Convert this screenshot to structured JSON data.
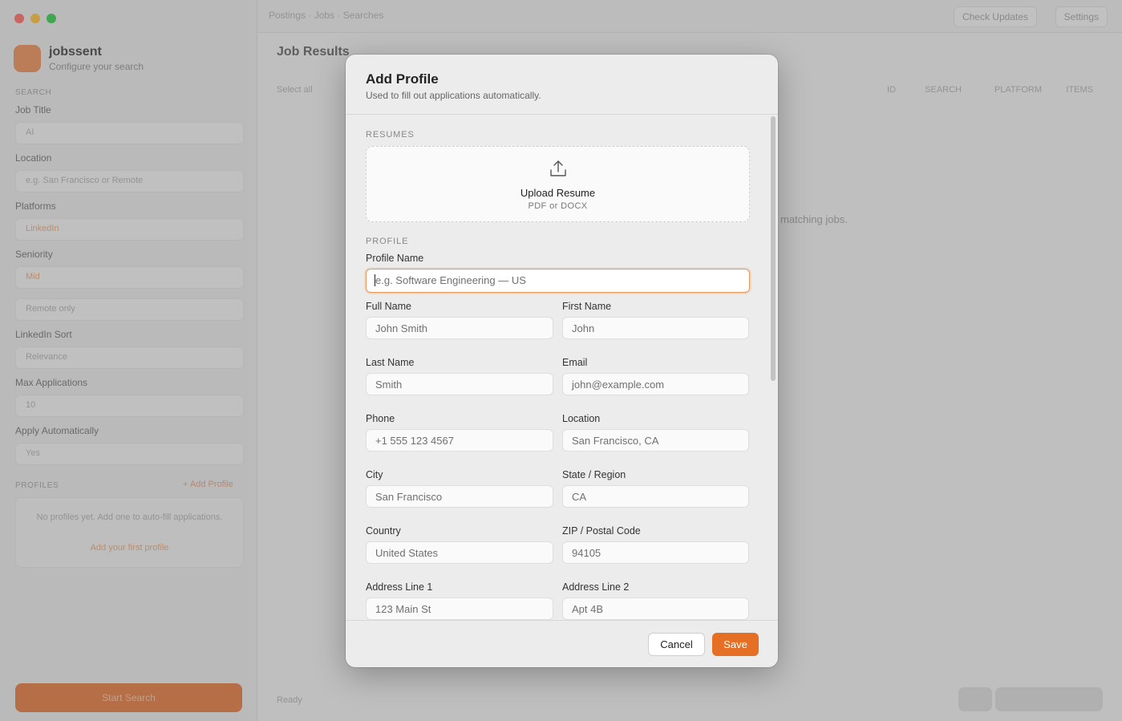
{
  "app": {
    "name": "jobssent",
    "subtitle": "Configure your search"
  },
  "sidebar": {
    "search_section": "SEARCH",
    "fields": [
      {
        "label": "Job Title",
        "value": "AI"
      },
      {
        "label": "Location",
        "value": "e.g. San Francisco or Remote"
      },
      {
        "label": "Platforms",
        "value": "LinkedIn"
      },
      {
        "label": "Seniority",
        "value": "Mid"
      },
      {
        "label": "",
        "value": "Remote only"
      },
      {
        "label": "LinkedIn Sort",
        "value": "Relevance"
      },
      {
        "label": "Max Applications",
        "value": "10"
      },
      {
        "label": "Apply Automatically",
        "value": "Yes"
      }
    ],
    "profiles_section": "PROFILES",
    "add_profile": "+ Add Profile",
    "profiles_empty": "No profiles yet. Add one to auto-fill applications.",
    "profiles_link": "Add your first profile",
    "run_button": "Start Search"
  },
  "toolbar": {
    "breadcrumb": "Postings · Jobs · Searches",
    "check_updates": "Check Updates",
    "settings": "Settings"
  },
  "main": {
    "title": "Job Results",
    "select_all": "Select all",
    "columns": [
      "ID",
      "SEARCH",
      "PLATFORM",
      "ITEMS"
    ],
    "empty_text": "matching jobs.",
    "status_left": "Ready"
  },
  "dialog": {
    "title": "Add Profile",
    "subtitle": "Used to fill out applications automatically.",
    "resumes_section": "RESUMES",
    "upload_title": "Upload Resume",
    "upload_sub": "PDF or DOCX",
    "profile_section": "PROFILE",
    "profile_name_label": "Profile Name",
    "profile_name_placeholder": "e.g. Software Engineering — US",
    "fields": [
      {
        "label": "Full Name",
        "placeholder": "John Smith"
      },
      {
        "label": "First Name",
        "placeholder": "John"
      },
      {
        "label": "Last Name",
        "placeholder": "Smith"
      },
      {
        "label": "Email",
        "placeholder": "john@example.com"
      },
      {
        "label": "Phone",
        "placeholder": "+1 555 123 4567"
      },
      {
        "label": "Location",
        "placeholder": "San Francisco, CA"
      },
      {
        "label": "City",
        "placeholder": "San Francisco"
      },
      {
        "label": "State / Region",
        "placeholder": "CA"
      },
      {
        "label": "Country",
        "placeholder": "United States"
      },
      {
        "label": "ZIP / Postal Code",
        "placeholder": "94105"
      },
      {
        "label": "Address Line 1",
        "placeholder": "123 Main St"
      },
      {
        "label": "Address Line 2",
        "placeholder": "Apt 4B"
      }
    ],
    "cancel": "Cancel",
    "save": "Save"
  },
  "colors": {
    "accent": "#e46f25",
    "focus_ring": "#e8955c"
  }
}
